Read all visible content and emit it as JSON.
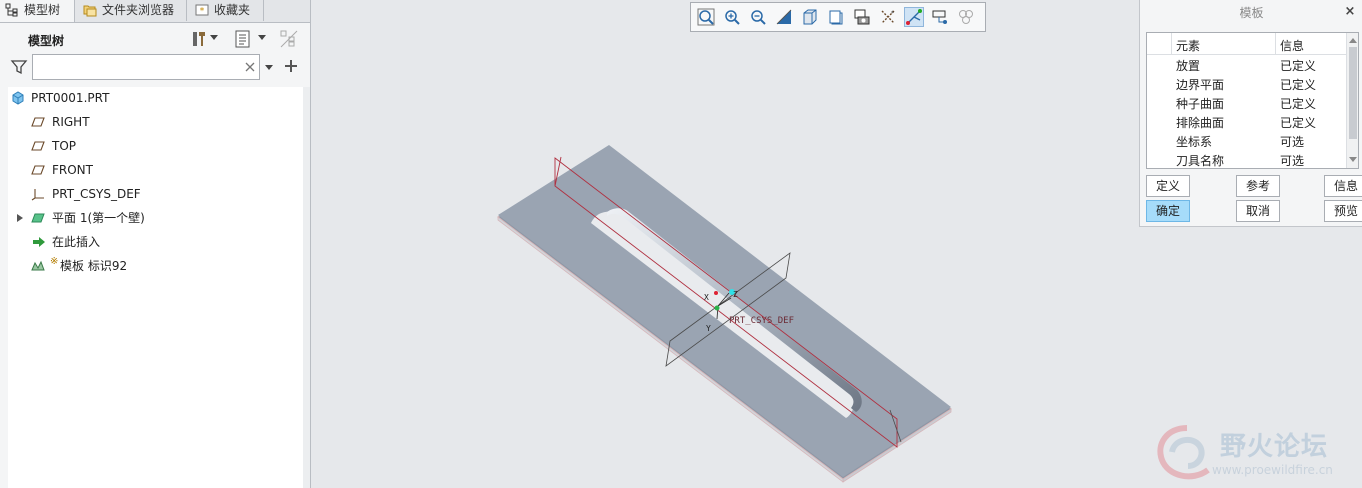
{
  "tabs": [
    {
      "label": "模型树",
      "icon": "model-tree-icon",
      "active": true
    },
    {
      "label": "文件夹浏览器",
      "icon": "folder-browser-icon",
      "active": false
    },
    {
      "label": "收藏夹",
      "icon": "favorites-star-icon",
      "active": false
    }
  ],
  "tree_panel": {
    "title": "模型树",
    "search": {
      "value": "",
      "placeholder": ""
    },
    "items": [
      {
        "label": "PRT0001.PRT",
        "icon": "part-cube-icon"
      },
      {
        "label": "RIGHT",
        "icon": "datum-plane-icon"
      },
      {
        "label": "TOP",
        "icon": "datum-plane-icon"
      },
      {
        "label": "FRONT",
        "icon": "datum-plane-icon"
      },
      {
        "label": "PRT_CSYS_DEF",
        "icon": "csys-icon"
      },
      {
        "label": "平面 1(第一个壁)",
        "icon": "sheetmetal-wall-icon"
      },
      {
        "label": "在此插入",
        "icon": "insert-here-arrow-icon"
      },
      {
        "label": "模板 标识92",
        "icon": "template-feature-icon",
        "prefix": "※"
      }
    ]
  },
  "viewport": {
    "csys_label": "PRT_CSYS_DEF",
    "axis_x": "X",
    "axis_y": "Y",
    "axis_z": "Z"
  },
  "dialog": {
    "title": "模板",
    "columns": [
      "元素",
      "信息"
    ],
    "rows": [
      {
        "element": "放置",
        "info": "已定义"
      },
      {
        "element": "边界平面",
        "info": "已定义"
      },
      {
        "element": "种子曲面",
        "info": "已定义"
      },
      {
        "element": "排除曲面",
        "info": "已定义"
      },
      {
        "element": "坐标系",
        "info": "可选"
      },
      {
        "element": "刀具名称",
        "info": "可选"
      }
    ],
    "buttons": {
      "define": "定义",
      "reference": "参考",
      "info": "信息",
      "ok": "确定",
      "cancel": "取消",
      "preview": "预览"
    }
  },
  "watermark": {
    "name": "野火论坛",
    "url": "www.proewildfire.cn"
  },
  "colors": {
    "accent_button": "#a6dcfa",
    "model_surface": "#9ba5b3",
    "datum_red": "#b03040"
  }
}
